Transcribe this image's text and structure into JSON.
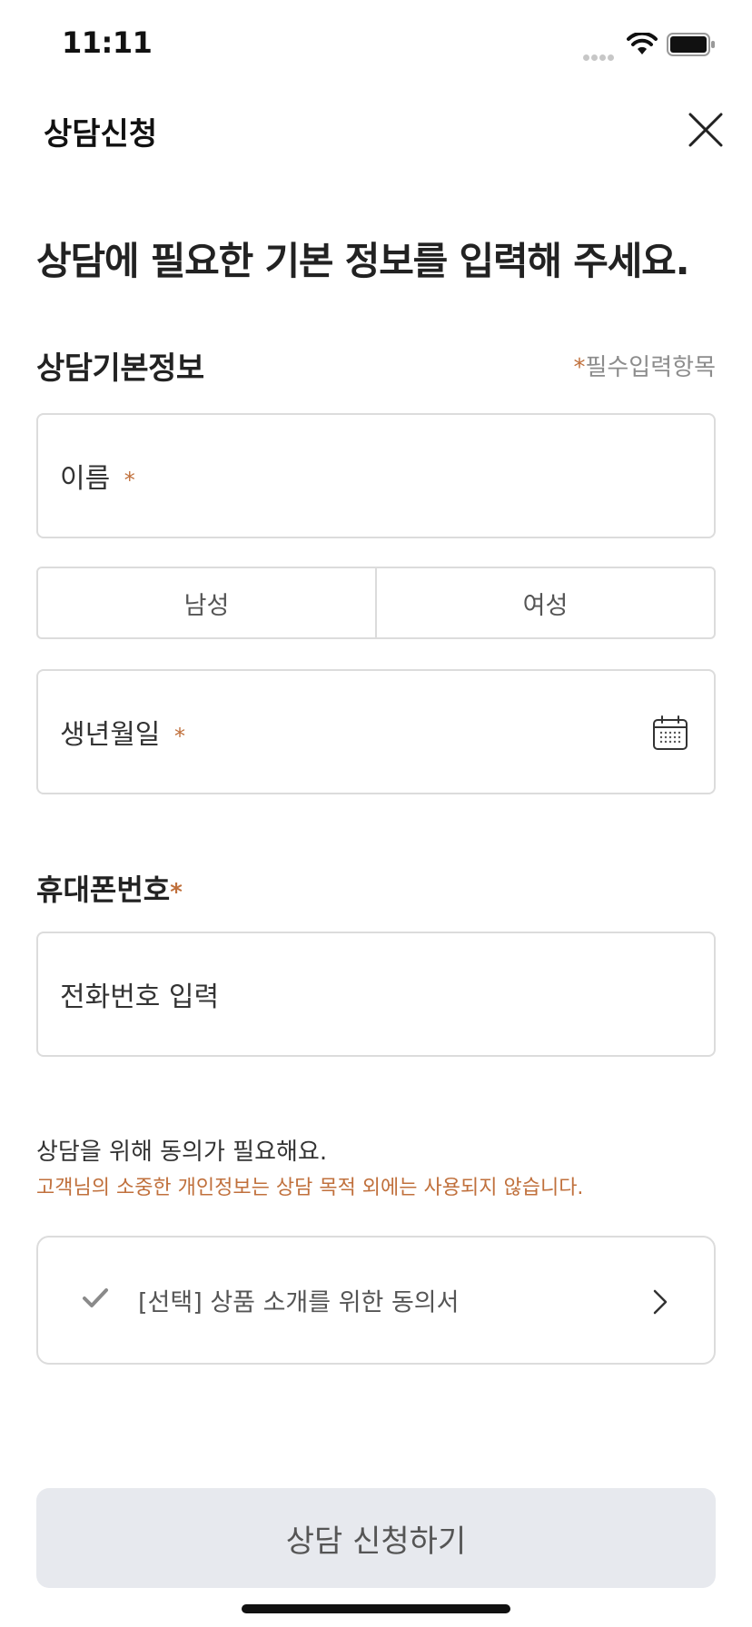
{
  "status_bar": {
    "time": "11:11"
  },
  "header": {
    "title": "상담신청",
    "close_icon": "close-icon"
  },
  "headline": "상담에 필요한 기본 정보를 입력해 주세요.",
  "basic_info": {
    "title": "상담기본정보",
    "required_star": "*",
    "required_note": "필수입력항목"
  },
  "name_field": {
    "label": "이름",
    "star": "*"
  },
  "gender": {
    "options": [
      "남성",
      "여성"
    ]
  },
  "birth_field": {
    "label": "생년월일",
    "star": "*",
    "icon": "calendar-icon"
  },
  "phone": {
    "title": "휴대폰번호",
    "star": "*",
    "placeholder": "전화번호 입력"
  },
  "consent": {
    "title": "상담을 위해 동의가 필요해요.",
    "subtitle": "고객님의 소중한 개인정보는 상담 목적 외에는 사용되지 않습니다.",
    "item_label": "[선택] 상품 소개를 위한 동의서"
  },
  "submit": {
    "label": "상담 신청하기"
  },
  "colors": {
    "accent": "#c0703c",
    "button_bg": "#e7e9ee",
    "border": "#dcdcdc"
  }
}
